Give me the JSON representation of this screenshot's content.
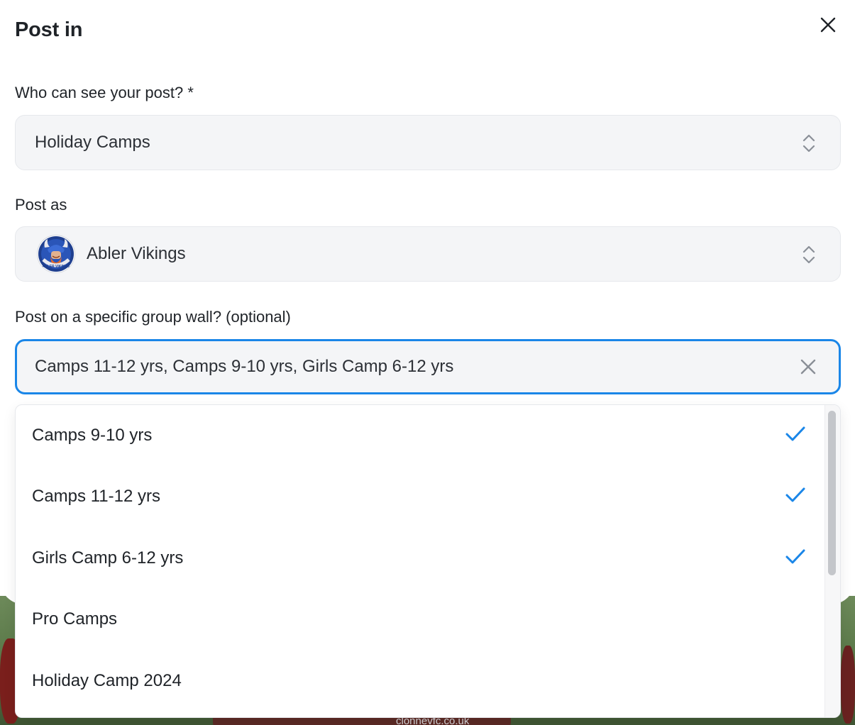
{
  "modal": {
    "title": "Post in",
    "close_icon": "close-icon"
  },
  "visibility": {
    "label": "Who can see your post? *",
    "value": "Holiday Camps"
  },
  "post_as": {
    "label": "Post as",
    "value": "Abler Vikings",
    "avatar_text": "ABLER VIKINGS"
  },
  "group_wall": {
    "label": "Post on a specific group wall? (optional)",
    "value": "Camps 11-12 yrs, Camps 9-10 yrs, Girls Camp 6-12 yrs"
  },
  "dropdown": {
    "options": [
      {
        "label": "Camps 9-10 yrs",
        "selected": true
      },
      {
        "label": "Camps 11-12 yrs",
        "selected": true
      },
      {
        "label": "Girls Camp 6-12 yrs",
        "selected": true
      },
      {
        "label": "Pro Camps",
        "selected": false
      },
      {
        "label": "Holiday Camp 2024",
        "selected": false
      }
    ]
  },
  "background": {
    "caption": "clonnevfc.co.uk"
  },
  "colors": {
    "accent": "#1a86e8",
    "field_bg": "#f4f5f7",
    "text": "#1f2328"
  }
}
